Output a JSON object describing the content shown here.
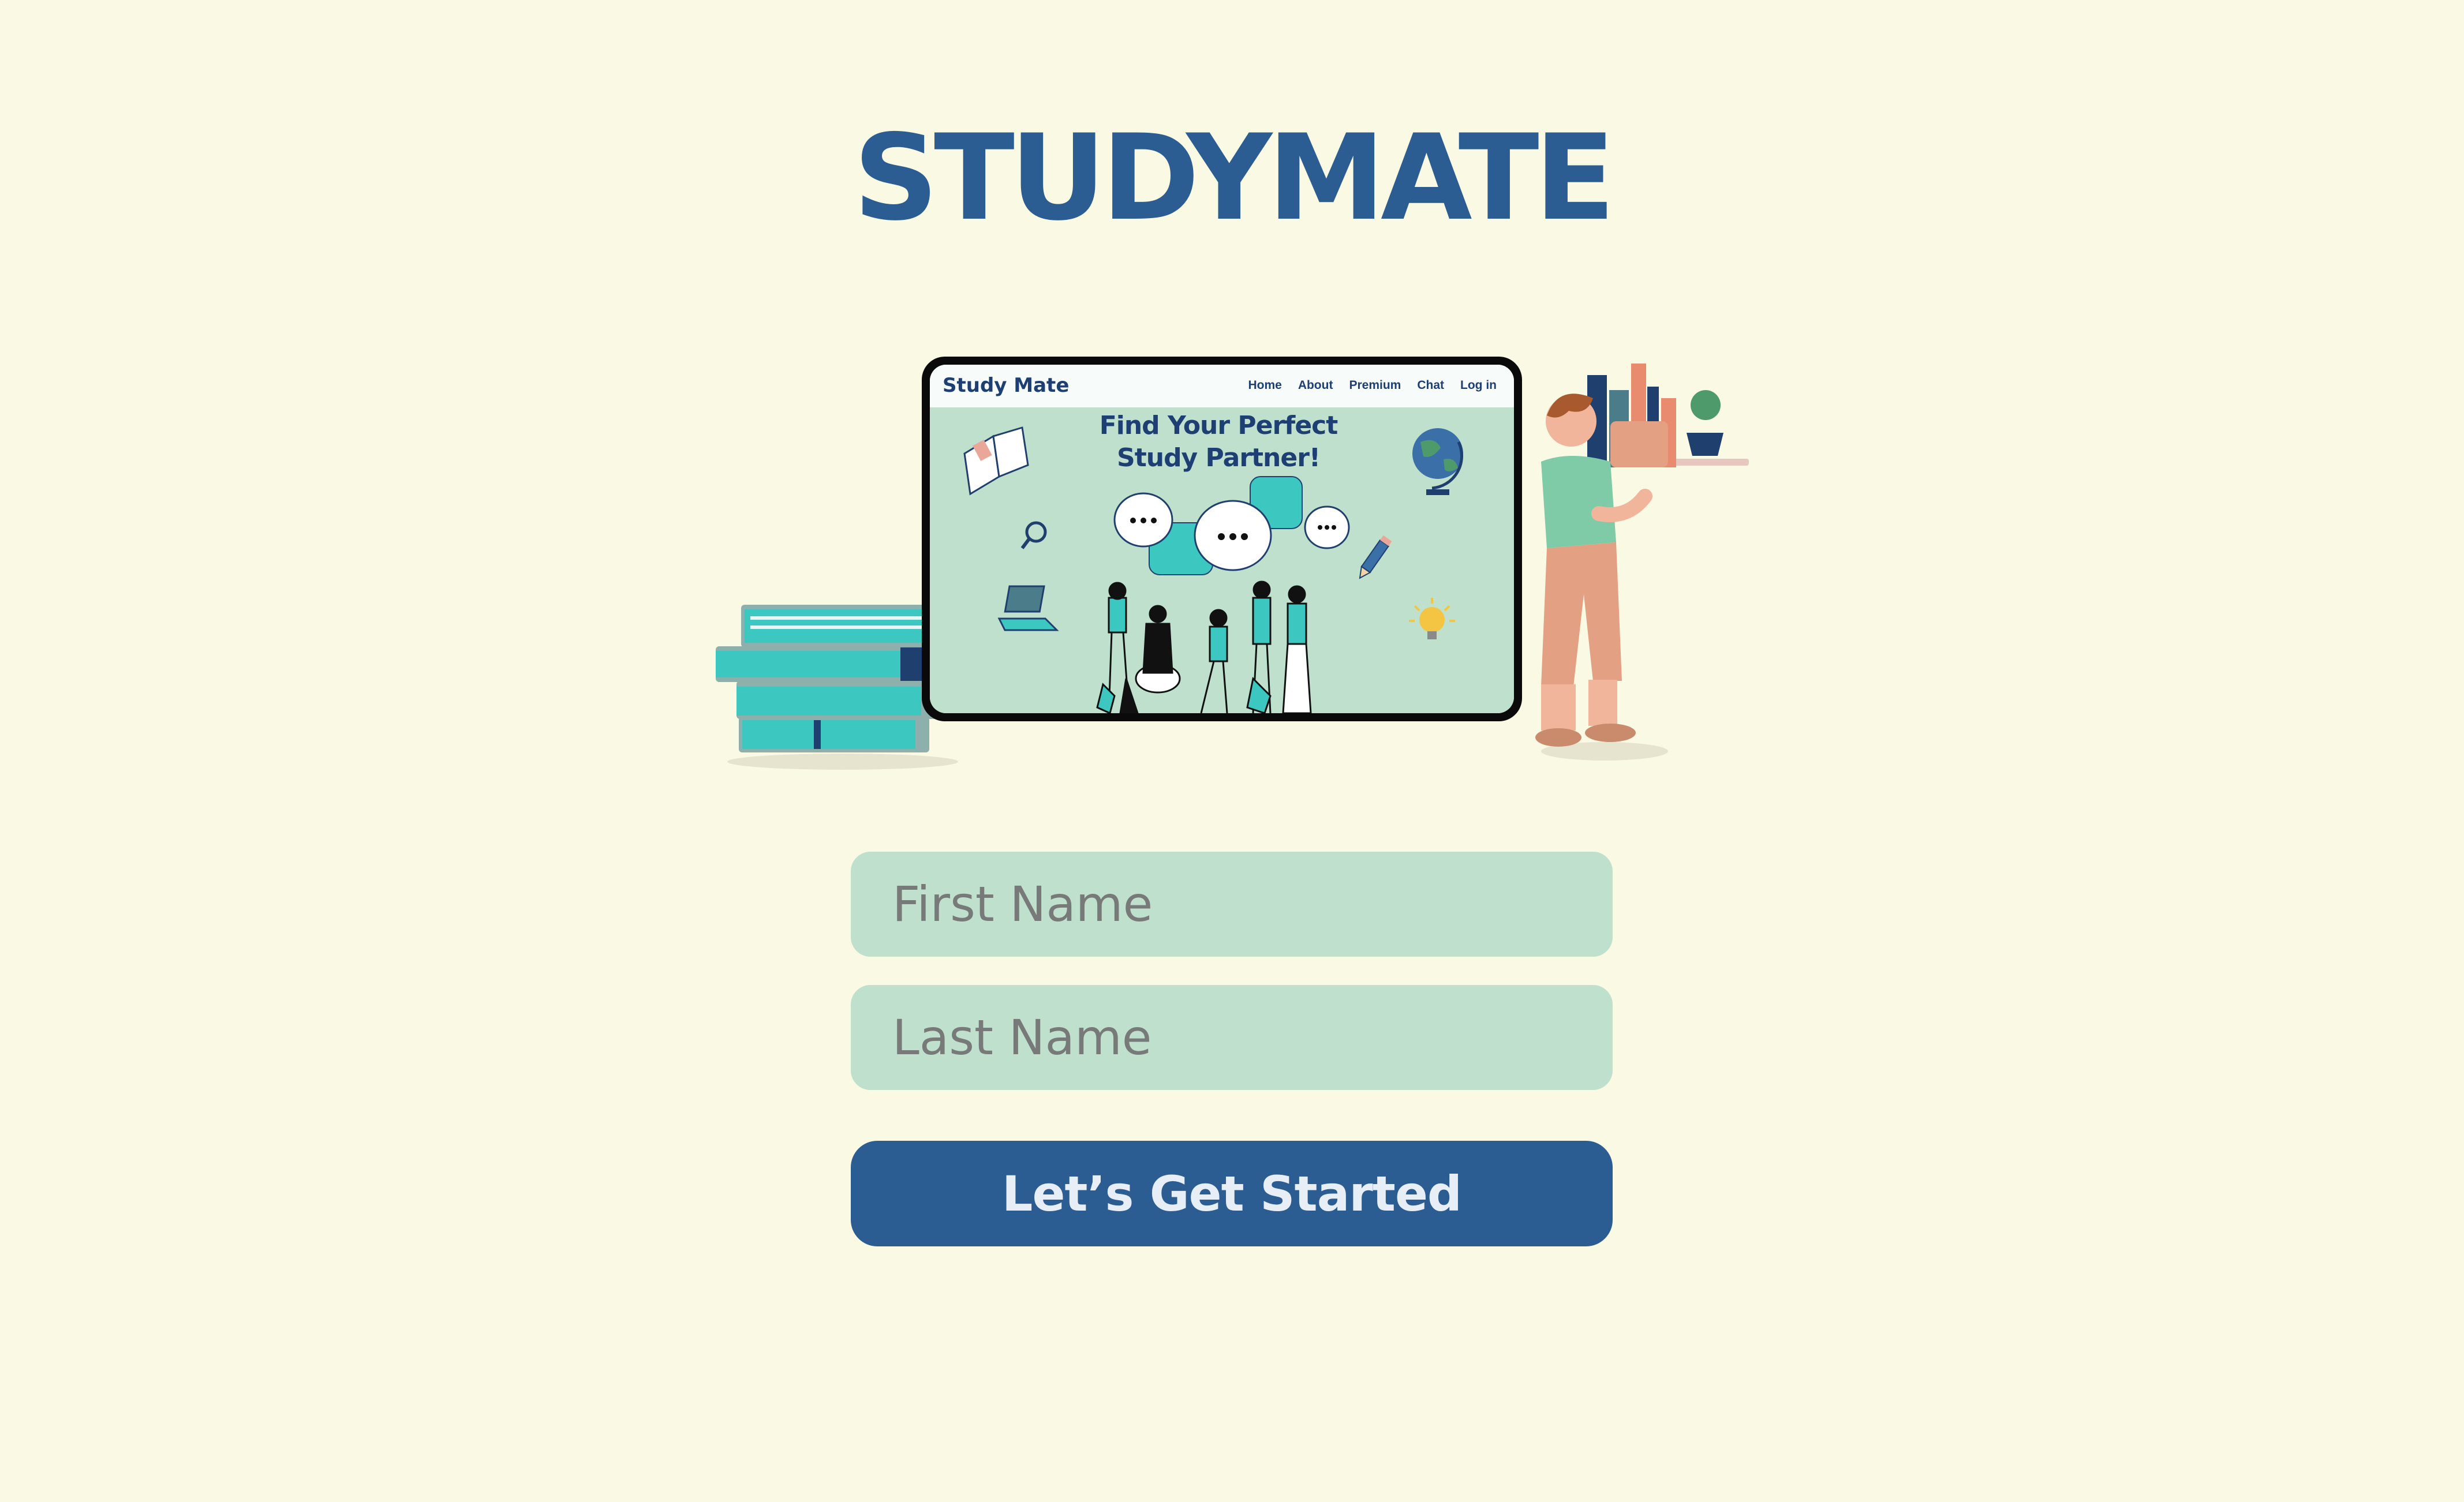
{
  "app": {
    "title": "STUDYMATE"
  },
  "illustration": {
    "preview_logo": "Study Mate",
    "preview_nav": [
      "Home",
      "About",
      "Premium",
      "Chat",
      "Log in"
    ],
    "preview_headline": "Find Your Perfect Study Partner!",
    "icons": [
      "book-stack-icon",
      "open-book-icon",
      "magnifier-icon",
      "laptop-icon",
      "globe-icon",
      "pencil-icon",
      "lightbulb-icon",
      "chat-bubble-icon",
      "person-carrying-books-icon"
    ]
  },
  "form": {
    "first_name_placeholder": "First Name",
    "last_name_placeholder": "Last Name",
    "submit_label": "Let’s Get Started"
  },
  "colors": {
    "background": "#faf9e3",
    "brand": "#2b5d92",
    "field": "#bfe0cc",
    "accent": "#3cc8c0"
  }
}
